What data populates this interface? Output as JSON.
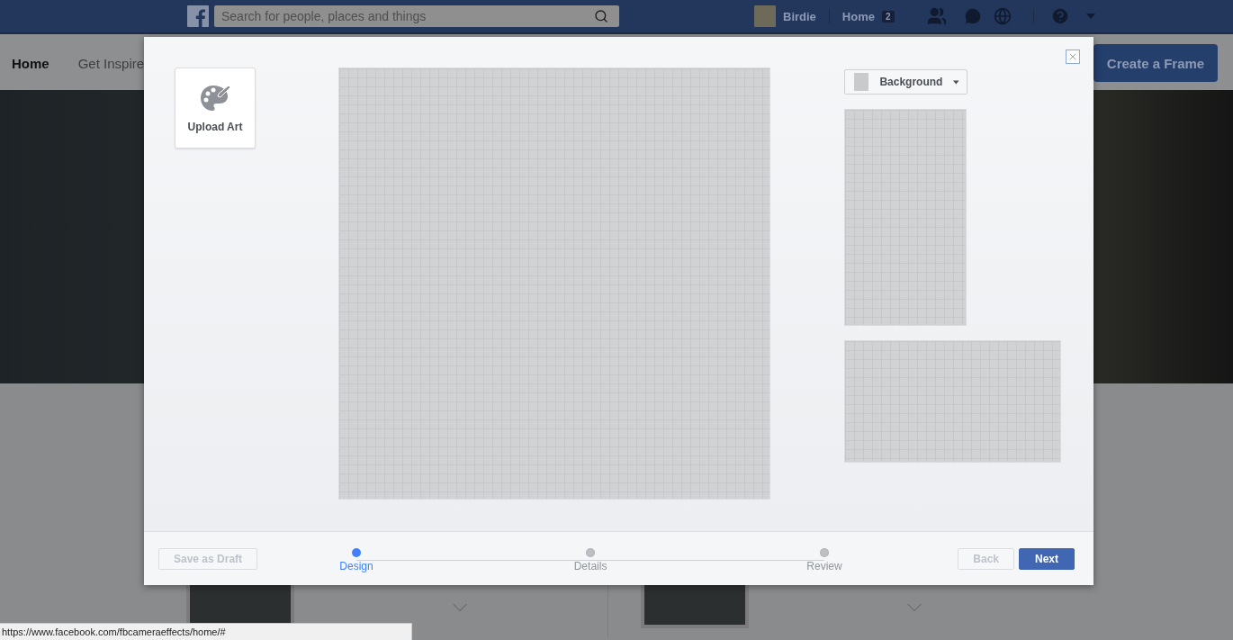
{
  "top_bar": {
    "search": {
      "placeholder": "Search for people, places and things"
    },
    "user_name": "Birdie",
    "home_link": "Home",
    "home_count": "2"
  },
  "sub_nav": {
    "items": [
      {
        "label": "Home",
        "selected": true
      },
      {
        "label": "Get Inspire",
        "selected": false
      }
    ],
    "create_button": "Create a Frame"
  },
  "modal": {
    "upload_label": "Upload Art",
    "background_dropdown": "Background",
    "steps": [
      {
        "label": "Design",
        "selected": true
      },
      {
        "label": "Details",
        "selected": false
      },
      {
        "label": "Review",
        "selected": false
      }
    ],
    "buttons": [
      {
        "label": "Save as Draft",
        "kind": "draft",
        "disabled": true
      },
      {
        "label": "Back",
        "kind": "secondary",
        "disabled": true
      },
      {
        "label": "Next",
        "kind": "primary",
        "disabled": false
      }
    ]
  },
  "status_bar": "https://www.facebook.com/fbcameraeffects/home/#"
}
